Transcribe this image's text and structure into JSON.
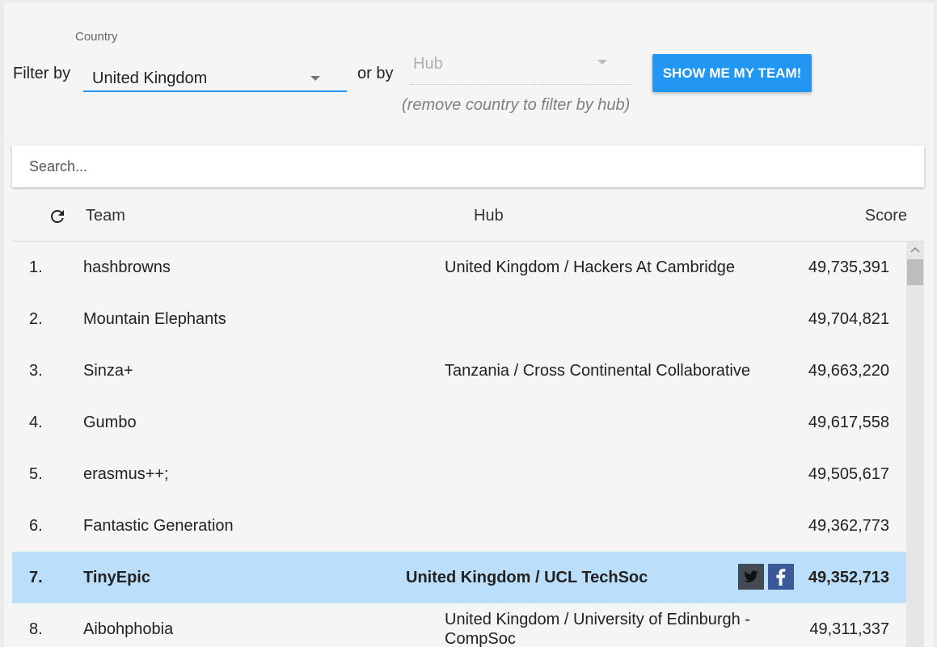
{
  "filters": {
    "filter_by_label": "Filter by",
    "country_caption": "Country",
    "country_value": "United Kingdom",
    "or_by_label": "or by",
    "hub_placeholder": "Hub",
    "hub_hint": "(remove country to filter by hub)",
    "team_button_label": "SHOW ME MY TEAM!"
  },
  "search": {
    "placeholder": "Search..."
  },
  "table": {
    "headers": {
      "team": "Team",
      "hub": "Hub",
      "score": "Score"
    },
    "rows": [
      {
        "rank": "1.",
        "team": "hashbrowns",
        "hub": "United Kingdom / Hackers At Cambridge",
        "score": "49,735,391"
      },
      {
        "rank": "2.",
        "team": "Mountain Elephants",
        "hub": "",
        "score": "49,704,821"
      },
      {
        "rank": "3.",
        "team": "Sinza+",
        "hub": "Tanzania / Cross Continental Collaborative",
        "score": "49,663,220"
      },
      {
        "rank": "4.",
        "team": "Gumbo",
        "hub": "",
        "score": "49,617,558"
      },
      {
        "rank": "5.",
        "team": "erasmus++;",
        "hub": "",
        "score": "49,505,617"
      },
      {
        "rank": "6.",
        "team": "Fantastic Generation",
        "hub": "",
        "score": "49,362,773"
      },
      {
        "rank": "7.",
        "team": "TinyEpic",
        "hub": "United Kingdom / UCL TechSoc",
        "score": "49,352,713",
        "highlighted": true,
        "share_icons": [
          "twitter-icon",
          "facebook-icon"
        ]
      },
      {
        "rank": "8.",
        "team": "Aibohphobia",
        "hub": "United Kingdom / University of Edinburgh - CompSoc",
        "score": "49,311,337"
      }
    ]
  },
  "colors": {
    "accent": "#2196f3",
    "highlight_row": "#bbdefb",
    "twitter_bg": "#424b54",
    "facebook_bg": "#3b5998"
  }
}
